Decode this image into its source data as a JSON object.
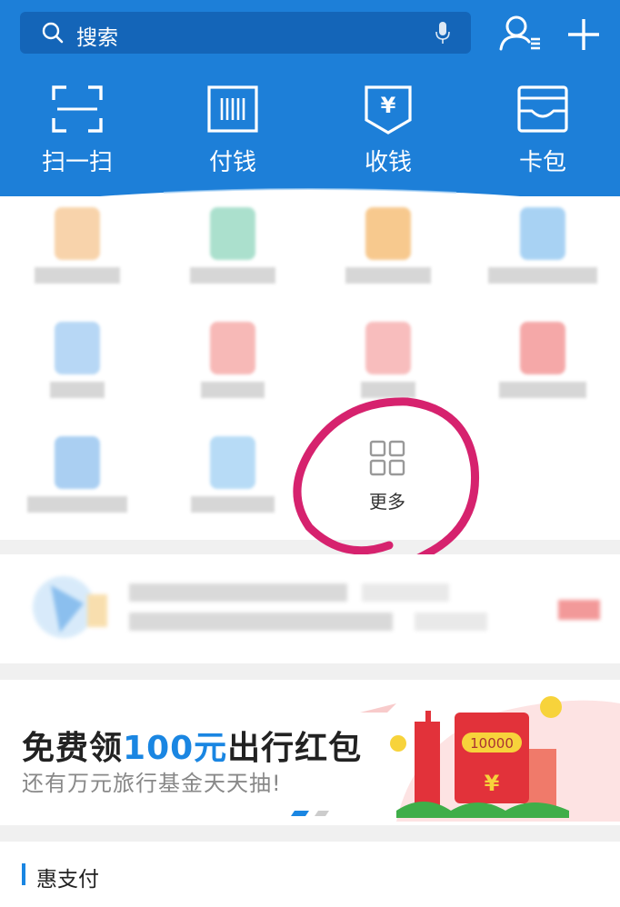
{
  "search": {
    "placeholder": "搜索",
    "icon": "search-icon",
    "voice_icon": "microphone-icon"
  },
  "header_icons": [
    "contacts-icon",
    "add-icon"
  ],
  "quick_actions": [
    {
      "label": "扫一扫",
      "icon": "scan-icon"
    },
    {
      "label": "付钱",
      "icon": "pay-barcode-icon"
    },
    {
      "label": "收钱",
      "icon": "receive-money-icon"
    },
    {
      "label": "卡包",
      "icon": "card-wallet-icon"
    }
  ],
  "more": {
    "label": "更多",
    "icon": "grid-icon"
  },
  "banner": {
    "title_pre": "免费领",
    "title_highlight": "100元",
    "title_post": "出行红包",
    "subtitle": "还有万元旅行基金天天抽!",
    "envelope_amount": "10000",
    "envelope_symbol": "¥"
  },
  "section": {
    "title": "惠支付"
  },
  "colors": {
    "header_blue": "#1d7fd8",
    "search_bg": "#1465b8",
    "highlight_blue": "#1a86e2",
    "annotation_magenta": "#d6226e",
    "banner_red": "#e2323a"
  }
}
